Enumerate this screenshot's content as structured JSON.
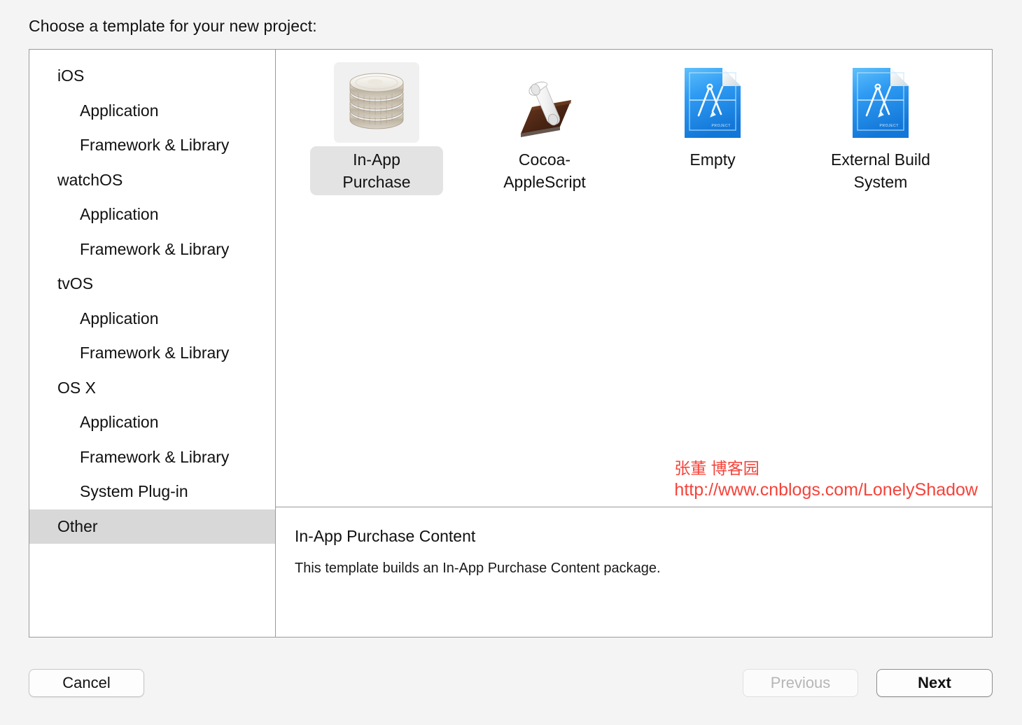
{
  "header": {
    "prompt": "Choose a template for your new project:"
  },
  "sidebar": {
    "items": [
      {
        "label": "iOS",
        "level": "group",
        "selected": false
      },
      {
        "label": "Application",
        "level": "child",
        "selected": false
      },
      {
        "label": "Framework & Library",
        "level": "child",
        "selected": false
      },
      {
        "label": "watchOS",
        "level": "group",
        "selected": false
      },
      {
        "label": "Application",
        "level": "child",
        "selected": false
      },
      {
        "label": "Framework & Library",
        "level": "child",
        "selected": false
      },
      {
        "label": "tvOS",
        "level": "group",
        "selected": false
      },
      {
        "label": "Application",
        "level": "child",
        "selected": false
      },
      {
        "label": "Framework & Library",
        "level": "child",
        "selected": false
      },
      {
        "label": "OS X",
        "level": "group",
        "selected": false
      },
      {
        "label": "Application",
        "level": "child",
        "selected": false
      },
      {
        "label": "Framework & Library",
        "level": "child",
        "selected": false
      },
      {
        "label": "System Plug-in",
        "level": "child",
        "selected": false
      },
      {
        "label": "Other",
        "level": "group",
        "selected": true
      }
    ]
  },
  "templates": [
    {
      "label": "In-App Purchase",
      "icon": "coin-stack-icon",
      "selected": true
    },
    {
      "label": "Cocoa-AppleScript",
      "icon": "scroll-icon",
      "selected": false
    },
    {
      "label": "Empty",
      "icon": "blueprint-icon",
      "selected": false
    },
    {
      "label": "External Build System",
      "icon": "blueprint-icon",
      "selected": false
    }
  ],
  "description": {
    "title": "In-App Purchase Content",
    "body": "This template builds an In-App Purchase Content package."
  },
  "watermark": {
    "line1": "张董 博客园",
    "line2": "http://www.cnblogs.com/LonelyShadow",
    "color": "#f4433a"
  },
  "footer": {
    "cancel_label": "Cancel",
    "previous_label": "Previous",
    "next_label": "Next"
  },
  "colors": {
    "background": "#f4f4f4",
    "panel_border": "#9a9a9a",
    "selection_row": "#d8d8d8",
    "selection_pill": "#e3e3e3",
    "blueprint_blue": "#2196f3",
    "watermark_red": "#f4433a"
  }
}
